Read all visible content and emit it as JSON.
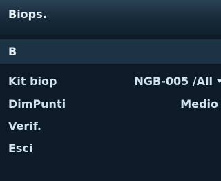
{
  "panel": {
    "title": "Biops.",
    "mode": "B"
  },
  "menu": {
    "kit_biop": {
      "label": "Kit biop",
      "value": "NGB-005 /All",
      "icon": "dropdown-caret-icon"
    },
    "dim_punti": {
      "label": "DimPunti",
      "value": "Medio"
    },
    "verif": {
      "label": "Verif."
    },
    "esci": {
      "label": "Esci"
    }
  },
  "colors": {
    "background": "#0c1b27",
    "mode_bar": "#1c3346",
    "text": "#d2e3ee"
  }
}
